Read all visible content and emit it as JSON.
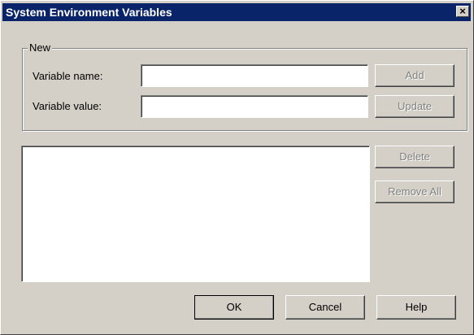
{
  "window": {
    "title": "System Environment Variables",
    "close_glyph": "×"
  },
  "new_group": {
    "legend": "New",
    "variable_name_label": "Variable name:",
    "variable_value_label": "Variable value:",
    "variable_name_value": "",
    "variable_value_value": "",
    "add_label": "Add",
    "update_label": "Update"
  },
  "list": {
    "items": [],
    "delete_label": "Delete",
    "remove_all_label": "Remove All"
  },
  "footer": {
    "ok_label": "OK",
    "cancel_label": "Cancel",
    "help_label": "Help"
  }
}
